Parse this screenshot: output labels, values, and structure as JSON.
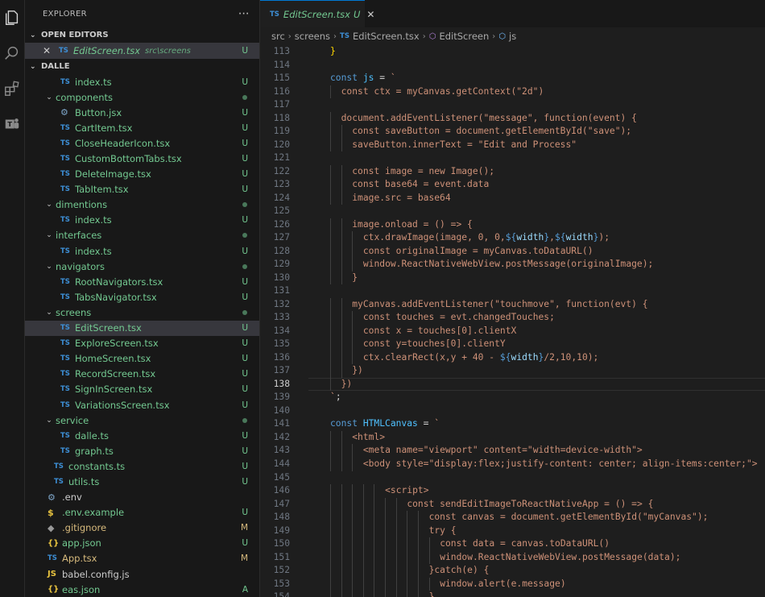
{
  "sidebar": {
    "title": "EXPLORER",
    "more_icon": "ellipsis-icon",
    "open_editors": {
      "label": "OPEN EDITORS",
      "items": [
        {
          "icon": "TS",
          "name": "EditScreen.tsx",
          "path": "src\\screens",
          "badge": "U"
        }
      ]
    },
    "project": {
      "label": "DALLE",
      "rows": [
        {
          "depth": 2,
          "icon": "TS",
          "name": "index.ts",
          "badge": "U"
        },
        {
          "depth": 1,
          "folder": true,
          "name": "components",
          "dot": true
        },
        {
          "depth": 2,
          "icon": "gear",
          "name": "Button.jsx",
          "badge": "U"
        },
        {
          "depth": 2,
          "icon": "TS",
          "name": "CartItem.tsx",
          "badge": "U"
        },
        {
          "depth": 2,
          "icon": "TS",
          "name": "CloseHeaderIcon.tsx",
          "badge": "U"
        },
        {
          "depth": 2,
          "icon": "TS",
          "name": "CustomBottomTabs.tsx",
          "badge": "U"
        },
        {
          "depth": 2,
          "icon": "TS",
          "name": "DeleteImage.tsx",
          "badge": "U"
        },
        {
          "depth": 2,
          "icon": "TS",
          "name": "TabItem.tsx",
          "badge": "U"
        },
        {
          "depth": 1,
          "folder": true,
          "name": "dimentions",
          "dot": true
        },
        {
          "depth": 2,
          "icon": "TS",
          "name": "index.ts",
          "badge": "U"
        },
        {
          "depth": 1,
          "folder": true,
          "name": "interfaces",
          "dot": true
        },
        {
          "depth": 2,
          "icon": "TS",
          "name": "index.ts",
          "badge": "U"
        },
        {
          "depth": 1,
          "folder": true,
          "name": "navigators",
          "dot": true
        },
        {
          "depth": 2,
          "icon": "TS",
          "name": "RootNavigators.tsx",
          "badge": "U"
        },
        {
          "depth": 2,
          "icon": "TS",
          "name": "TabsNavigator.tsx",
          "badge": "U"
        },
        {
          "depth": 1,
          "folder": true,
          "name": "screens",
          "dot": true
        },
        {
          "depth": 2,
          "icon": "TS",
          "name": "EditScreen.tsx",
          "badge": "U",
          "selected": true
        },
        {
          "depth": 2,
          "icon": "TS",
          "name": "ExploreScreen.tsx",
          "badge": "U"
        },
        {
          "depth": 2,
          "icon": "TS",
          "name": "HomeScreen.tsx",
          "badge": "U"
        },
        {
          "depth": 2,
          "icon": "TS",
          "name": "RecordScreen.tsx",
          "badge": "U"
        },
        {
          "depth": 2,
          "icon": "TS",
          "name": "SignInScreen.tsx",
          "badge": "U"
        },
        {
          "depth": 2,
          "icon": "TS",
          "name": "VariationsScreen.tsx",
          "badge": "U"
        },
        {
          "depth": 1,
          "folder": true,
          "name": "service",
          "dot": true
        },
        {
          "depth": 2,
          "icon": "TS",
          "name": "dalle.ts",
          "badge": "U"
        },
        {
          "depth": 2,
          "icon": "TS",
          "name": "graph.ts",
          "badge": "U"
        },
        {
          "depth": 1,
          "icon": "TS",
          "name": "constants.ts",
          "badge": "U"
        },
        {
          "depth": 1,
          "icon": "TS",
          "name": "utils.ts",
          "badge": "U"
        },
        {
          "depth": 0,
          "icon": "gear",
          "name": ".env",
          "plain": true
        },
        {
          "depth": 0,
          "icon": "$",
          "name": ".env.example",
          "badge": "U"
        },
        {
          "depth": 0,
          "icon": "git",
          "name": ".gitignore",
          "badge": "M",
          "mod": true
        },
        {
          "depth": 0,
          "icon": "{}",
          "name": "app.json",
          "badge": "U"
        },
        {
          "depth": 0,
          "icon": "TS",
          "name": "App.tsx",
          "badge": "M",
          "mod": true
        },
        {
          "depth": 0,
          "icon": "JS",
          "name": "babel.config.js",
          "plain": true
        },
        {
          "depth": 0,
          "icon": "{}",
          "name": "eas.json",
          "badge": "A"
        }
      ]
    }
  },
  "tab": {
    "icon": "TS",
    "name": "EditScreen.tsx",
    "status": "U",
    "close": "close-icon"
  },
  "breadcrumb": [
    "src",
    "screens",
    "EditScreen.tsx",
    "EditScreen",
    "js"
  ],
  "editor": {
    "current_line": 138,
    "lines": [
      {
        "n": 113,
        "i": 2,
        "c": [
          [
            "}",
            "y"
          ]
        ]
      },
      {
        "n": 114,
        "i": 0,
        "c": []
      },
      {
        "n": 115,
        "i": 2,
        "c": [
          [
            "const ",
            "k"
          ],
          [
            "js",
            "v"
          ],
          [
            " = ",
            "n"
          ],
          [
            "`",
            "s"
          ]
        ]
      },
      {
        "n": 116,
        "i": 3,
        "c": [
          [
            "const ctx = myCanvas.getContext(\"2d\")",
            "s"
          ]
        ]
      },
      {
        "n": 117,
        "i": 0,
        "c": []
      },
      {
        "n": 118,
        "i": 3,
        "c": [
          [
            "document.addEventListener(\"message\", function(event) {",
            "s"
          ]
        ]
      },
      {
        "n": 119,
        "i": 4,
        "c": [
          [
            "const saveButton = document.getElementById(\"save\");",
            "s"
          ]
        ]
      },
      {
        "n": 120,
        "i": 4,
        "c": [
          [
            "saveButton.innerText = \"Edit and Process\"",
            "s"
          ]
        ]
      },
      {
        "n": 121,
        "i": 0,
        "c": []
      },
      {
        "n": 122,
        "i": 4,
        "c": [
          [
            "const image = new Image();",
            "s"
          ]
        ]
      },
      {
        "n": 123,
        "i": 4,
        "c": [
          [
            "const base64 = event.data",
            "s"
          ]
        ]
      },
      {
        "n": 124,
        "i": 4,
        "c": [
          [
            "image.src = base64",
            "s"
          ]
        ]
      },
      {
        "n": 125,
        "i": 0,
        "c": []
      },
      {
        "n": 126,
        "i": 4,
        "c": [
          [
            "image.onload = () => {",
            "s"
          ]
        ]
      },
      {
        "n": 127,
        "i": 5,
        "c": [
          [
            "ctx.drawImage(image, 0, 0,",
            "s"
          ],
          [
            "${",
            "k"
          ],
          [
            "width",
            "vv"
          ],
          [
            "}",
            "k"
          ],
          [
            ",",
            "s"
          ],
          [
            "${",
            "k"
          ],
          [
            "width",
            "vv"
          ],
          [
            "}",
            "k"
          ],
          [
            ");",
            "s"
          ]
        ]
      },
      {
        "n": 128,
        "i": 5,
        "c": [
          [
            "const originalImage = myCanvas.toDataURL()",
            "s"
          ]
        ]
      },
      {
        "n": 129,
        "i": 5,
        "c": [
          [
            "window.ReactNativeWebView.postMessage(originalImage);",
            "s"
          ]
        ]
      },
      {
        "n": 130,
        "i": 4,
        "c": [
          [
            "}",
            "s"
          ]
        ]
      },
      {
        "n": 131,
        "i": 0,
        "c": []
      },
      {
        "n": 132,
        "i": 4,
        "c": [
          [
            "myCanvas.addEventListener(\"touchmove\", function(evt) {",
            "s"
          ]
        ]
      },
      {
        "n": 133,
        "i": 5,
        "c": [
          [
            "const touches = evt.changedTouches;",
            "s"
          ]
        ]
      },
      {
        "n": 134,
        "i": 5,
        "c": [
          [
            "const x = touches[0].clientX",
            "s"
          ]
        ]
      },
      {
        "n": 135,
        "i": 5,
        "c": [
          [
            "const y=touches[0].clientY",
            "s"
          ]
        ]
      },
      {
        "n": 136,
        "i": 5,
        "c": [
          [
            "ctx.clearRect(x,y + 40 - ",
            "s"
          ],
          [
            "${",
            "k"
          ],
          [
            "width",
            "vv"
          ],
          [
            "}",
            "k"
          ],
          [
            "/2,10,10);",
            "s"
          ]
        ]
      },
      {
        "n": 137,
        "i": 4,
        "c": [
          [
            "})",
            "s"
          ]
        ]
      },
      {
        "n": 138,
        "i": 3,
        "c": [
          [
            "})",
            "s"
          ]
        ]
      },
      {
        "n": 139,
        "i": 2,
        "c": [
          [
            "`",
            "s"
          ],
          [
            ";",
            "n"
          ]
        ]
      },
      {
        "n": 140,
        "i": 0,
        "c": []
      },
      {
        "n": 141,
        "i": 2,
        "c": [
          [
            "const ",
            "k"
          ],
          [
            "HTMLCanvas",
            "v"
          ],
          [
            " = ",
            "n"
          ],
          [
            "`",
            "s"
          ]
        ]
      },
      {
        "n": 142,
        "i": 4,
        "c": [
          [
            "<html>",
            "s"
          ]
        ]
      },
      {
        "n": 143,
        "i": 5,
        "c": [
          [
            "<meta name=\"viewport\" content=\"width=device-width\">",
            "s"
          ]
        ]
      },
      {
        "n": 144,
        "i": 5,
        "c": [
          [
            "<body style=\"display:flex;justify-content: center; align-items:center;\">",
            "s"
          ]
        ]
      },
      {
        "n": 145,
        "i": 0,
        "c": []
      },
      {
        "n": 146,
        "i": 7,
        "c": [
          [
            "<script>",
            "s"
          ]
        ]
      },
      {
        "n": 147,
        "i": 9,
        "c": [
          [
            "const sendEditImageToReactNativeApp = () => {",
            "s"
          ]
        ]
      },
      {
        "n": 148,
        "i": 11,
        "c": [
          [
            "const canvas = document.getElementById(\"myCanvas\");",
            "s"
          ]
        ]
      },
      {
        "n": 149,
        "i": 11,
        "c": [
          [
            "try {",
            "s"
          ]
        ]
      },
      {
        "n": 150,
        "i": 12,
        "c": [
          [
            "const data = canvas.toDataURL()",
            "s"
          ]
        ]
      },
      {
        "n": 151,
        "i": 12,
        "c": [
          [
            "window.ReactNativeWebView.postMessage(data);",
            "s"
          ]
        ]
      },
      {
        "n": 152,
        "i": 11,
        "c": [
          [
            "}catch(e) {",
            "s"
          ]
        ]
      },
      {
        "n": 153,
        "i": 12,
        "c": [
          [
            "window.alert(e.message)",
            "s"
          ]
        ]
      },
      {
        "n": 154,
        "i": 11,
        "c": [
          [
            "}",
            "s"
          ]
        ]
      }
    ]
  },
  "icons": [
    "files-icon",
    "search-icon",
    "extensions-icon",
    "teams-icon"
  ]
}
